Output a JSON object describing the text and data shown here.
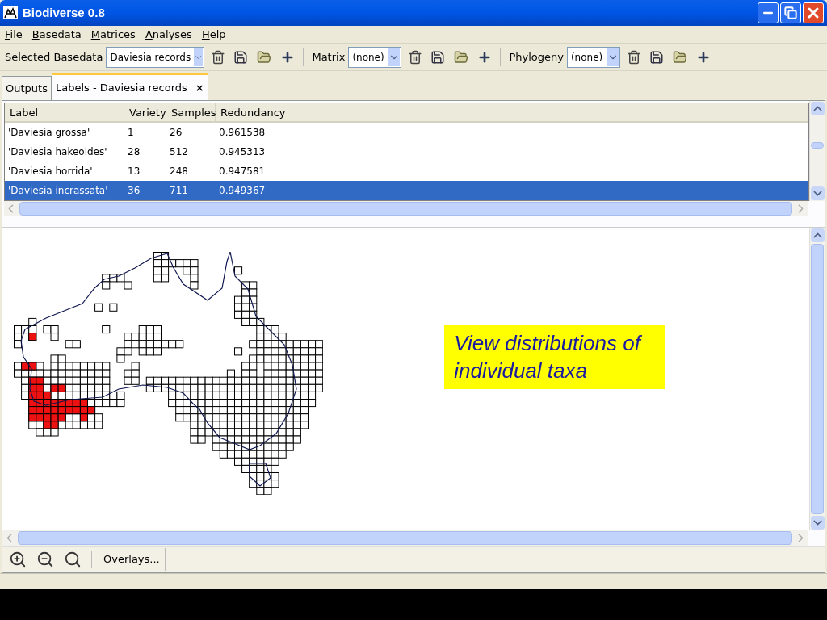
{
  "window": {
    "title": "Biodiverse 0.8"
  },
  "menu": [
    "File",
    "Basedata",
    "Matrices",
    "Analyses",
    "Help"
  ],
  "toolbar": [
    {
      "label": "Selected Basedata",
      "value": "Daviesia records"
    },
    {
      "label": "Matrix",
      "value": "(none)"
    },
    {
      "label": "Phylogeny",
      "value": "(none)"
    }
  ],
  "tabs": [
    {
      "label": "Outputs",
      "selected": false
    },
    {
      "label": "Labels - Daviesia records",
      "selected": true,
      "close": "×"
    }
  ],
  "table": {
    "columns": [
      "Label",
      "Variety",
      "Samples",
      "Redundancy"
    ],
    "rows": [
      {
        "cells": [
          "'Daviesia grossa'",
          "1",
          "26",
          "0.961538"
        ],
        "selected": false
      },
      {
        "cells": [
          "'Daviesia hakeoides'",
          "28",
          "512",
          "0.945313"
        ],
        "selected": false
      },
      {
        "cells": [
          "'Daviesia horrida'",
          "13",
          "248",
          "0.947581"
        ],
        "selected": false
      },
      {
        "cells": [
          "'Daviesia incrassata'",
          "36",
          "711",
          "0.949367"
        ],
        "selected": true
      }
    ]
  },
  "callout": {
    "text": "View distributions of individual taxa"
  },
  "map_toolbar": {
    "button": "Overlays..."
  }
}
